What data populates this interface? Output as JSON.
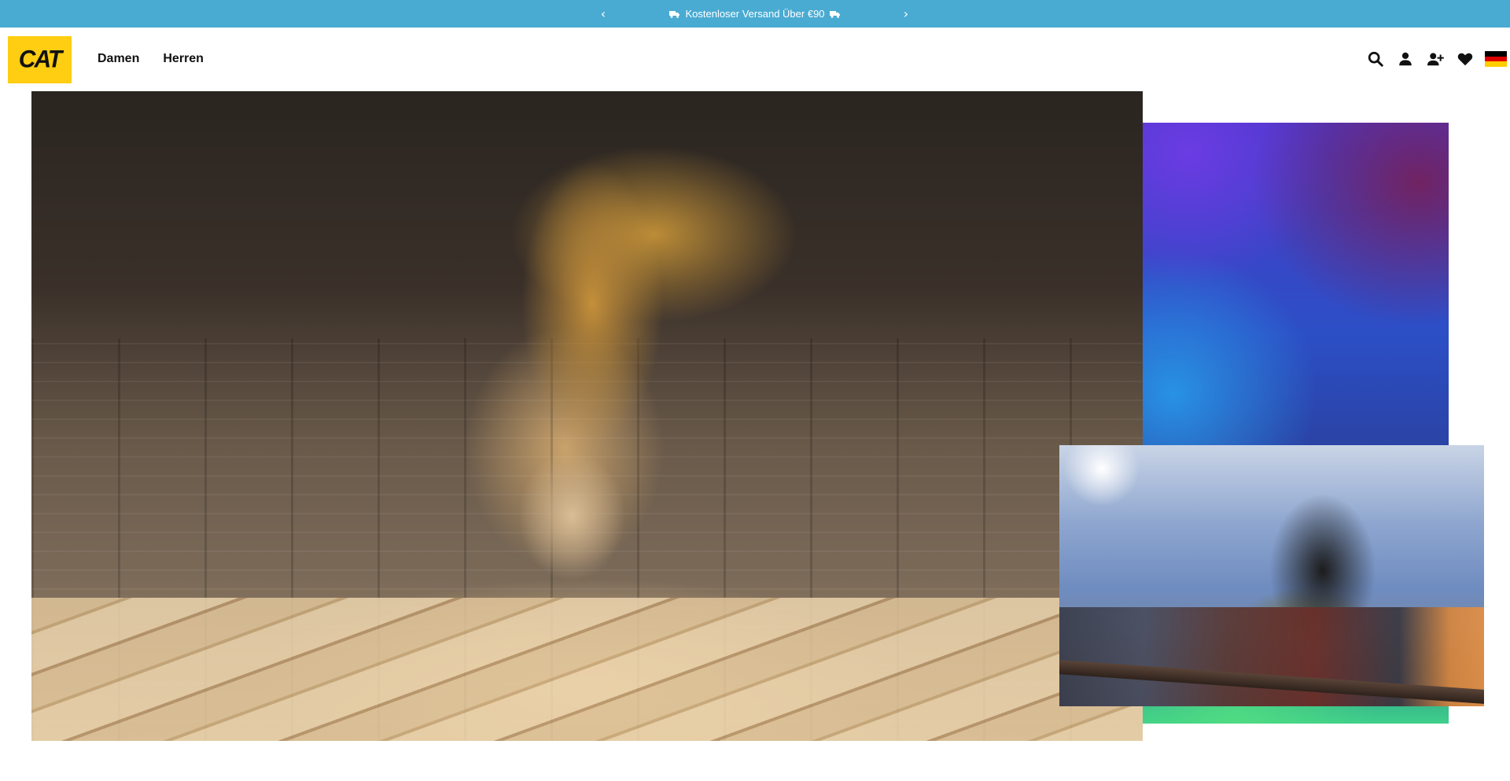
{
  "promo": {
    "message": "Kostenloser Versand Über €90",
    "prev_arrow": "‹",
    "next_arrow": "›",
    "icon": "truck-icon"
  },
  "header": {
    "logo_text": "CAT",
    "nav": [
      {
        "label": "Damen"
      },
      {
        "label": "Herren"
      }
    ],
    "icons": [
      "search-icon",
      "account-icon",
      "register-icon",
      "wishlist-icon",
      "country-flag-de"
    ]
  },
  "colors": {
    "promo_bg": "#4aabd2",
    "brand_yellow": "#ffcd11",
    "flag_black": "#000000",
    "flag_red": "#dd0000",
    "flag_gold": "#ffce00"
  }
}
